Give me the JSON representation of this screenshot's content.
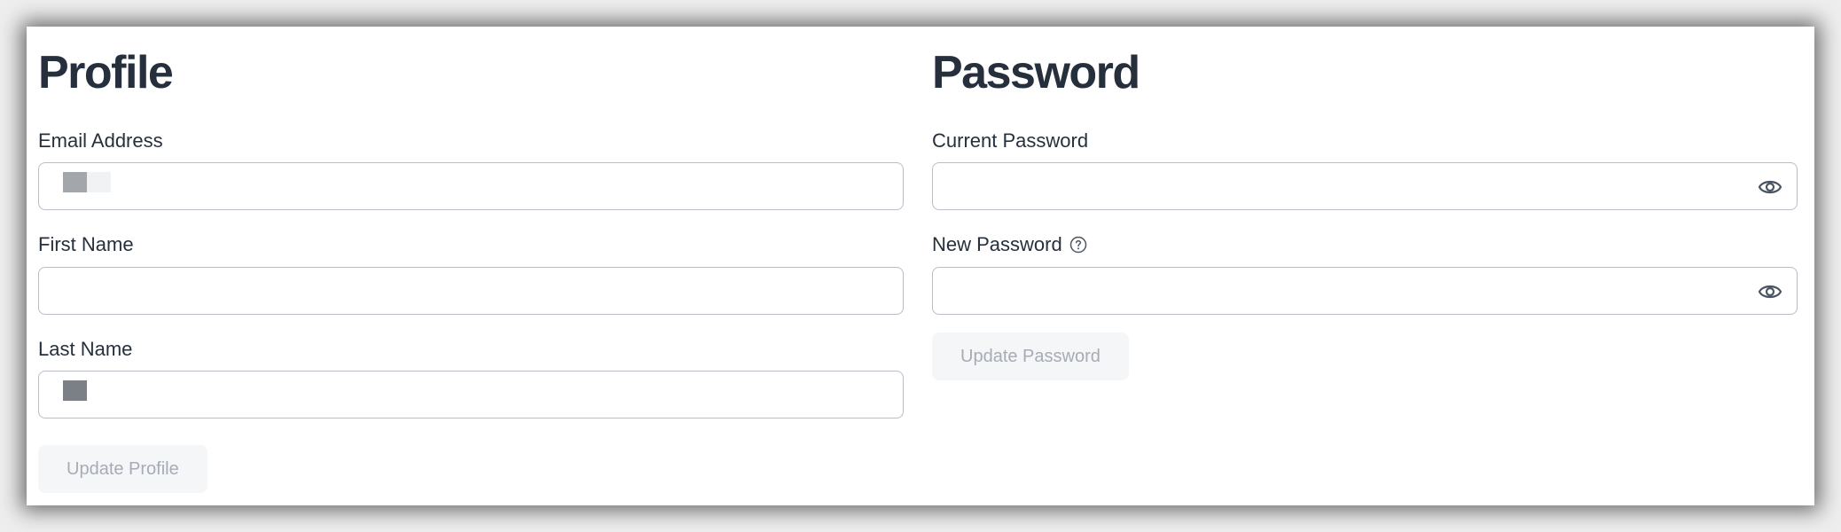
{
  "profile": {
    "title": "Profile",
    "email_label": "Email Address",
    "first_name_label": "First Name",
    "last_name_label": "Last Name",
    "update_button": "Update Profile"
  },
  "password": {
    "title": "Password",
    "current_label": "Current Password",
    "new_label": "New Password",
    "update_button": "Update Password"
  },
  "icons": {
    "eye": "eye-icon",
    "help": "help-circle-icon"
  },
  "colors": {
    "heading": "#26303d",
    "border": "#b9bec6",
    "button_bg": "#f5f6f8",
    "button_text": "#a6acb5"
  }
}
